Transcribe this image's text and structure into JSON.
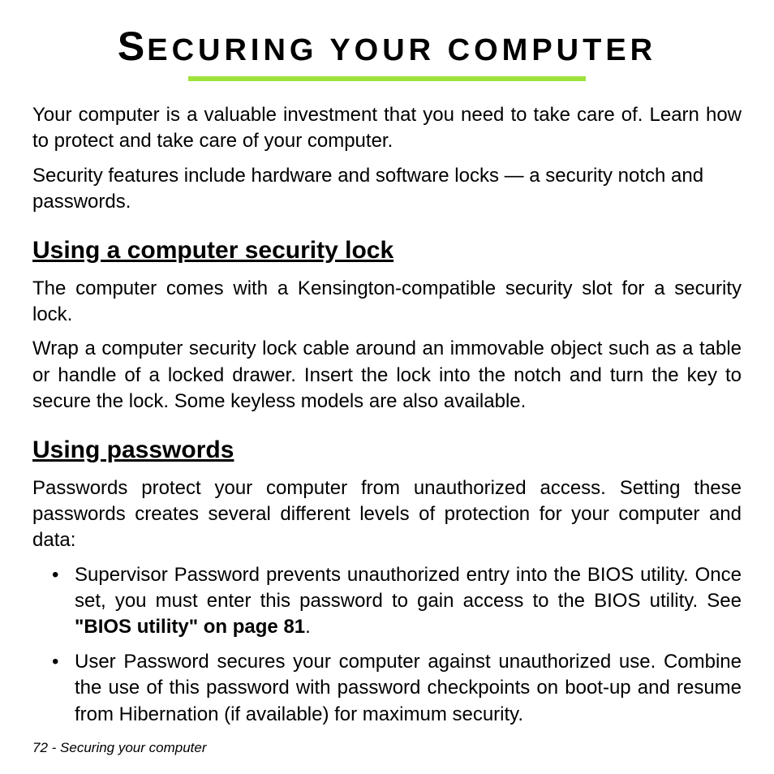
{
  "title": {
    "first_letter": "S",
    "rest": "ECURING YOUR COMPUTER"
  },
  "intro": {
    "p1": "Your computer is a valuable investment that you need to take care of. Learn how to protect and take care of your computer.",
    "p2": "Security features include hardware and software locks — a security notch and passwords."
  },
  "section1": {
    "heading": "Using a computer security lock",
    "p1": "The computer comes with a Kensington-compatible security slot for a security lock.",
    "p2": "Wrap a computer security lock cable around an immovable object such as a table or handle of a locked drawer. Insert the lock into the notch and turn the key to secure the lock. Some keyless models are also available."
  },
  "section2": {
    "heading": "Using passwords",
    "p1": "Passwords protect your computer from unauthorized access. Setting these passwords creates several different levels of protection for your computer and data:",
    "bullets": [
      {
        "pre": "Supervisor Password prevents unauthorized entry into the BIOS utility. Once set, you must enter this password to gain access to the BIOS utility. See ",
        "bold": "\"BIOS utility\" on page 81",
        "post": "."
      },
      {
        "pre": "User Password secures your computer against unauthorized use. Combine the use of this password with password checkpoints on boot-up and resume from Hibernation (if available) for maximum security.",
        "bold": "",
        "post": ""
      }
    ]
  },
  "footer": {
    "page_number": "72",
    "separator": " - ",
    "section_name": "Securing your computer"
  }
}
